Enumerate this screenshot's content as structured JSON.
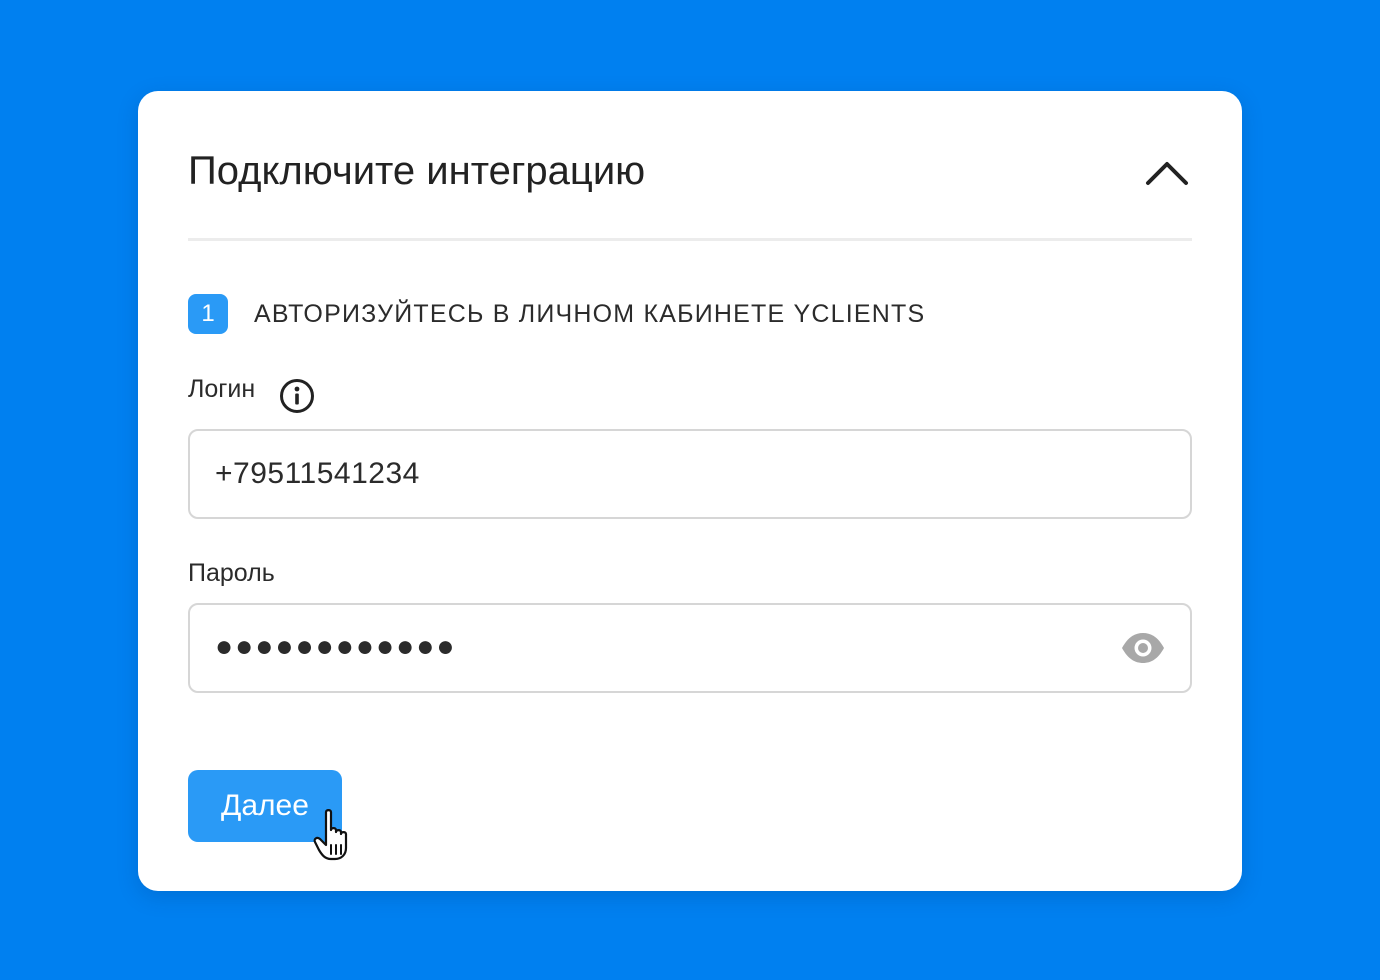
{
  "card": {
    "title": "Подключите интеграцию",
    "collapse_icon": "chevron-up-icon"
  },
  "step": {
    "number": "1",
    "title": "АВТОРИЗУЙТЕСЬ В ЛИЧНОМ КАБИНЕТЕ YCLIENTS"
  },
  "login": {
    "label": "Логин",
    "info_icon": "info-icon",
    "value": "+79511541234"
  },
  "password": {
    "label": "Пароль",
    "masked_value": "●●●●●●●●●●●●",
    "toggle_icon": "eye-icon"
  },
  "next_button": {
    "label": "Далее"
  },
  "colors": {
    "background": "#0080f0",
    "accent": "#2a9af6",
    "text": "#2b2b2b",
    "border": "#d6d6d6",
    "icon_muted": "#a8a8a8"
  }
}
